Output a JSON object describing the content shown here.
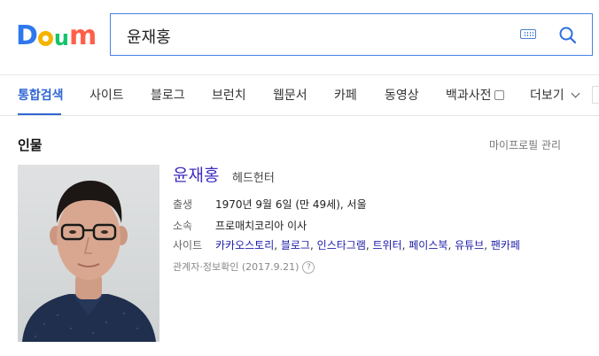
{
  "logo": {
    "letters": [
      "D",
      "a",
      "u",
      "m"
    ],
    "colors": {
      "d": "#2e77ee",
      "a": "#f5b400",
      "u": "#14c36c",
      "m": "#ff5f4a"
    }
  },
  "search": {
    "value": "윤재홍",
    "border_color": "#4682e6"
  },
  "tabs": [
    {
      "label": "통합검색",
      "active": true
    },
    {
      "label": "사이트"
    },
    {
      "label": "블로그"
    },
    {
      "label": "브런치"
    },
    {
      "label": "웹문서"
    },
    {
      "label": "카페"
    },
    {
      "label": "동영상"
    },
    {
      "label": "백과사전"
    },
    {
      "label": "더보기"
    }
  ],
  "person": {
    "section_title": "인물",
    "manage_link": "마이프로필 관리",
    "name": "윤재홍",
    "title": "헤드헌터",
    "birth_label": "출생",
    "birth_value": "1970년 9월 6일 (만 49세), 서울",
    "affiliation_label": "소속",
    "affiliation_value": "프로매치코리아 이사",
    "site_label": "사이트",
    "sites": [
      "카카오스토리",
      "블로그",
      "인스타그램",
      "트위터",
      "페이스북",
      "유튜브",
      "팬카페"
    ],
    "verification_note": "관계자·정보확인 (2017.9.21)",
    "help_icon": "?"
  },
  "accent_color": "#3067d4"
}
